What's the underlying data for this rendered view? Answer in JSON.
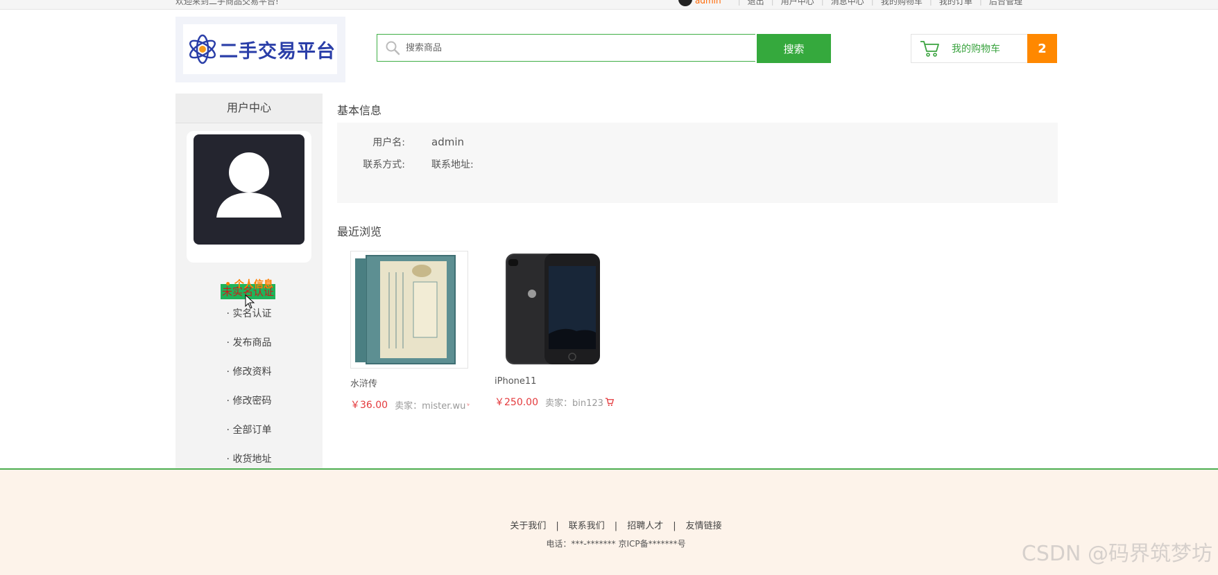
{
  "topbar": {
    "welcome": "欢迎来到二手商品交易平台!",
    "username": "admin",
    "nav_items": [
      "退出",
      "用户中心",
      "消息中心",
      "我的购物车",
      "我的订单",
      "后台管理"
    ]
  },
  "header": {
    "logo_text": "二手交易平台",
    "search": {
      "placeholder": "搜索商品",
      "button": "搜索"
    },
    "cart": {
      "label": "我的购物车",
      "count": "2"
    }
  },
  "sidebar": {
    "title": "用户中心",
    "verify_badge": "未实名认证",
    "menu": [
      {
        "label": "• 个人信息",
        "active": true
      },
      {
        "label": "· 实名认证"
      },
      {
        "label": "· 发布商品"
      },
      {
        "label": "· 修改资料"
      },
      {
        "label": "· 修改密码"
      },
      {
        "label": "· 全部订单"
      },
      {
        "label": "· 收货地址"
      }
    ]
  },
  "basic_info": {
    "title": "基本信息",
    "username_label": "用户名:",
    "username_value": "admin",
    "contact_label": "联系方式:",
    "address_label": "联系地址:"
  },
  "recent": {
    "title": "最近浏览",
    "products": [
      {
        "name": "水浒传",
        "price": "￥36.00",
        "seller": "卖家：mister.wu"
      },
      {
        "name": "iPhone11",
        "price": "￥250.00",
        "seller": "卖家：bin123"
      }
    ]
  },
  "footer": {
    "links": [
      "关于我们",
      "联系我们",
      "招聘人才",
      "友情链接"
    ],
    "copyright": "电话：***-******* 京ICP备*******号"
  },
  "watermark": "CSDN @码界筑梦坊",
  "colors": {
    "brand_green": "#35a93d",
    "accent_orange": "#ff8800",
    "price_red": "#e4393c",
    "logo_blue": "#2a3ea8"
  }
}
